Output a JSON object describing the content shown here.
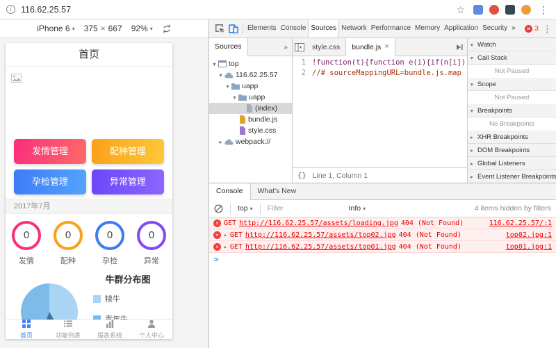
{
  "browser": {
    "url": "116.62.25.57"
  },
  "device_toolbar": {
    "device": "iPhone 6",
    "width": "375",
    "times": "×",
    "height": "667",
    "zoom": "92%"
  },
  "app": {
    "header_title": "首页",
    "action_buttons": [
      {
        "label": "发情管理"
      },
      {
        "label": "配种管理"
      },
      {
        "label": "孕检管理"
      },
      {
        "label": "异常管理"
      }
    ],
    "month_label": "2017年7月",
    "stats": [
      {
        "label": "发情",
        "value": "0"
      },
      {
        "label": "配种",
        "value": "0"
      },
      {
        "label": "孕检",
        "value": "0"
      },
      {
        "label": "异常",
        "value": "0"
      }
    ],
    "pie_title": "牛群分布图",
    "legend": [
      {
        "label": "犊牛"
      },
      {
        "label": "青年牛"
      }
    ],
    "tabbar": [
      {
        "label": "首页"
      },
      {
        "label": "功能列表"
      },
      {
        "label": "报表系统"
      },
      {
        "label": "个人中心"
      }
    ]
  },
  "devtools": {
    "tabs": [
      "Elements",
      "Console",
      "Sources",
      "Network",
      "Performance",
      "Memory",
      "Application",
      "Security"
    ],
    "error_count": "3",
    "navigator": {
      "tab": "Sources",
      "tree": [
        "top",
        "116.62.25.57",
        "uapp",
        "uapp",
        "(index)",
        "bundle.js",
        "style.css",
        "webpack://"
      ]
    },
    "editor": {
      "tab_inactive": "style.css",
      "tab_active": "bundle.js",
      "lines": [
        {
          "num": "1",
          "code": "!function(t){function e(i){if(n[i])return n[i"
        },
        {
          "num": "2",
          "code": "//# sourceMappingURL=bundle.js.map"
        }
      ],
      "status": "Line 1, Column 1"
    },
    "debugger": {
      "sections": [
        {
          "label": "Watch"
        },
        {
          "label": "Call Stack",
          "note": "Not Paused"
        },
        {
          "label": "Scope",
          "note": "Not Paused"
        },
        {
          "label": "Breakpoints",
          "note": "No Breakpoints"
        },
        {
          "label": "XHR Breakpoints"
        },
        {
          "label": "DOM Breakpoints"
        },
        {
          "label": "Global Listeners"
        },
        {
          "label": "Event Listener Breakpoints"
        }
      ]
    },
    "console": {
      "tabs": [
        "Console",
        "What's New"
      ],
      "context": "top",
      "filter_placeholder": "Filter",
      "level": "Info",
      "hidden_note": "4 items hidden by filters",
      "messages": [
        {
          "prefix": "GET",
          "url": "http://116.62.25.57/assets/loading.jpg",
          "status": "404 (Not Found)",
          "source": "116.62.25.57/:1"
        },
        {
          "prefix": "GET",
          "url": "http://116.62.25.57/assets/top02.jpg",
          "status": "404 (Not Found)",
          "source": "top02.jpg:1"
        },
        {
          "prefix": "GET",
          "url": "http://116.62.25.57/assets/top01.jpg",
          "status": "404 (Not Found)",
          "source": "top01.jpg:1"
        }
      ]
    }
  },
  "icons": {
    "info": "i",
    "star": "☆",
    "menu": "⋮",
    "dropdown": "▾",
    "collapse": "▾",
    "expand": "▸",
    "more": "»",
    "close": "×",
    "braces": "{}",
    "prompt": ">"
  },
  "colors": {
    "accent_blue": "#4285f4",
    "btn_estrus": "#fb2e7b",
    "btn_breeding": "#fba018",
    "btn_pregnancy": "#3d7bf8",
    "btn_abnormal": "#6b46fa",
    "ring_estrus": "#fb2e7b",
    "ring_breeding": "#fba018",
    "ring_pregnancy": "#3d7bf8",
    "ring_abnormal": "#8048fa",
    "pie_calf": "#a9d4f2",
    "pie_young": "#7fbbe9",
    "pie_dark": "#41719f",
    "error_red": "#e60000"
  }
}
